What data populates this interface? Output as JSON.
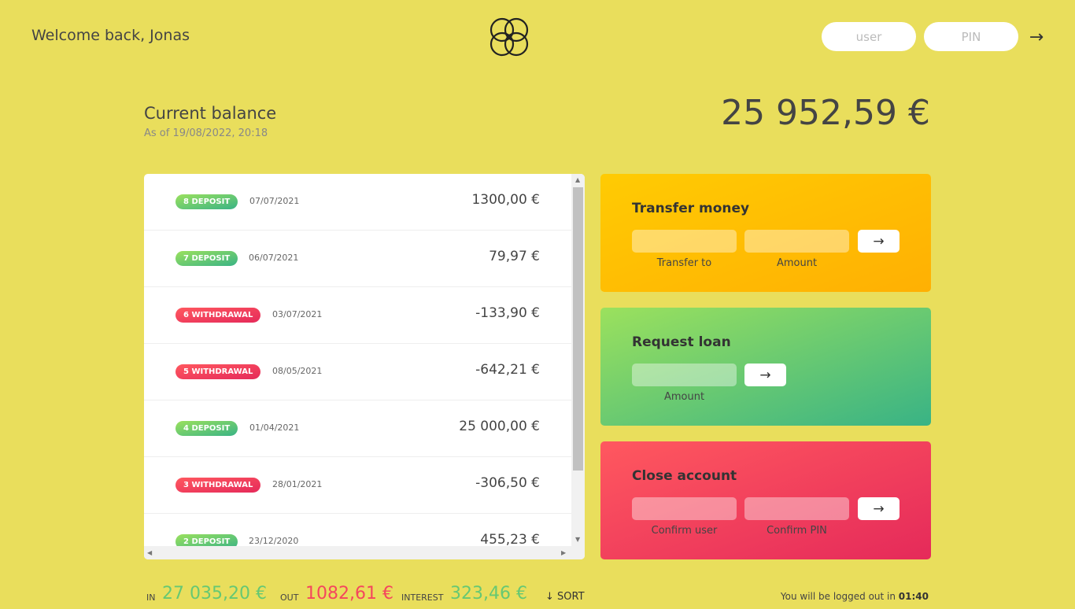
{
  "nav": {
    "welcome": "Welcome back, Jonas",
    "user_placeholder": "user",
    "pin_placeholder": "PIN",
    "login_arrow": "→"
  },
  "balance": {
    "label": "Current balance",
    "date": "As of 19/08/2022, 20:18",
    "value": "25 952,59 €"
  },
  "movements": [
    {
      "type": "8 DEPOSIT",
      "kind": "deposit",
      "date": "07/07/2021",
      "value": "1300,00 €"
    },
    {
      "type": "7 DEPOSIT",
      "kind": "deposit",
      "date": "06/07/2021",
      "value": "79,97 €"
    },
    {
      "type": "6 WITHDRAWAL",
      "kind": "withdrawal",
      "date": "03/07/2021",
      "value": "-133,90 €"
    },
    {
      "type": "5 WITHDRAWAL",
      "kind": "withdrawal",
      "date": "08/05/2021",
      "value": "-642,21 €"
    },
    {
      "type": "4 DEPOSIT",
      "kind": "deposit",
      "date": "01/04/2021",
      "value": "25 000,00 €"
    },
    {
      "type": "3 WITHDRAWAL",
      "kind": "withdrawal",
      "date": "28/01/2021",
      "value": "-306,50 €"
    },
    {
      "type": "2 DEPOSIT",
      "kind": "deposit",
      "date": "23/12/2020",
      "value": "455,23 €"
    }
  ],
  "operations": {
    "transfer": {
      "title": "Transfer money",
      "label_to": "Transfer to",
      "label_amount": "Amount",
      "btn": "→"
    },
    "loan": {
      "title": "Request loan",
      "label_amount": "Amount",
      "btn": "→"
    },
    "close": {
      "title": "Close account",
      "label_user": "Confirm user",
      "label_pin": "Confirm PIN",
      "btn": "→"
    }
  },
  "summary": {
    "in_label": "IN",
    "in_value": "27 035,20 €",
    "out_label": "OUT",
    "out_value": "1082,61 €",
    "interest_label": "INTEREST",
    "interest_value": "323,46 €",
    "sort": "↓ SORT"
  },
  "logout": {
    "text": "You will be logged out in ",
    "timer": "01:40"
  },
  "colors": {
    "background": "#e9de5c",
    "deposit": "#66c873",
    "withdrawal": "#f5465d"
  }
}
